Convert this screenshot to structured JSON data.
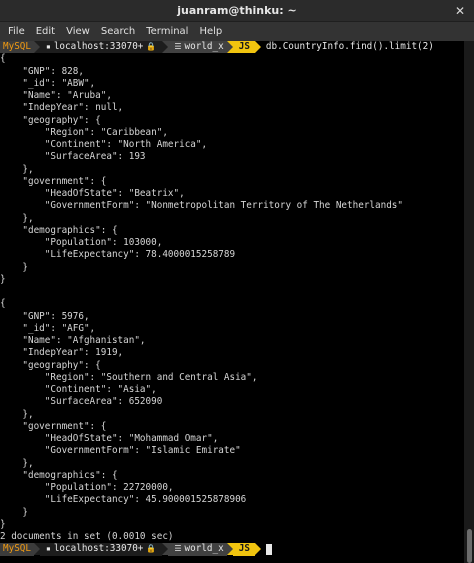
{
  "window": {
    "title": "juanram@thinku: ~"
  },
  "menu": [
    "File",
    "Edit",
    "View",
    "Search",
    "Terminal",
    "Help"
  ],
  "prompt": {
    "shell": "MySQL",
    "host": "localhost:33070+",
    "schema": "world_x",
    "mode": "JS",
    "command": "db.CountryInfo.find().limit(2)"
  },
  "output_lines": [
    "{",
    "    \"GNP\": 828,",
    "    \"_id\": \"ABW\",",
    "    \"Name\": \"Aruba\",",
    "    \"IndepYear\": null,",
    "    \"geography\": {",
    "        \"Region\": \"Caribbean\",",
    "        \"Continent\": \"North America\",",
    "        \"SurfaceArea\": 193",
    "    },",
    "    \"government\": {",
    "        \"HeadOfState\": \"Beatrix\",",
    "        \"GovernmentForm\": \"Nonmetropolitan Territory of The Netherlands\"",
    "    },",
    "    \"demographics\": {",
    "        \"Population\": 103000,",
    "        \"LifeExpectancy\": 78.4000015258789",
    "    }",
    "}",
    "{",
    "    \"GNP\": 5976,",
    "    \"_id\": \"AFG\",",
    "    \"Name\": \"Afghanistan\",",
    "    \"IndepYear\": 1919,",
    "    \"geography\": {",
    "        \"Region\": \"Southern and Central Asia\",",
    "        \"Continent\": \"Asia\",",
    "        \"SurfaceArea\": 652090",
    "    },",
    "    \"government\": {",
    "        \"HeadOfState\": \"Mohammad Omar\",",
    "        \"GovernmentForm\": \"Islamic Emirate\"",
    "    },",
    "    \"demographics\": {",
    "        \"Population\": 22720000,",
    "        \"LifeExpectancy\": 45.900001525878906",
    "    }",
    "}",
    "2 documents in set (0.0010 sec)"
  ],
  "blank_after_line": [
    18
  ],
  "icons": {
    "close": "close-icon",
    "lock": "lock-icon",
    "database": "database-icon"
  }
}
